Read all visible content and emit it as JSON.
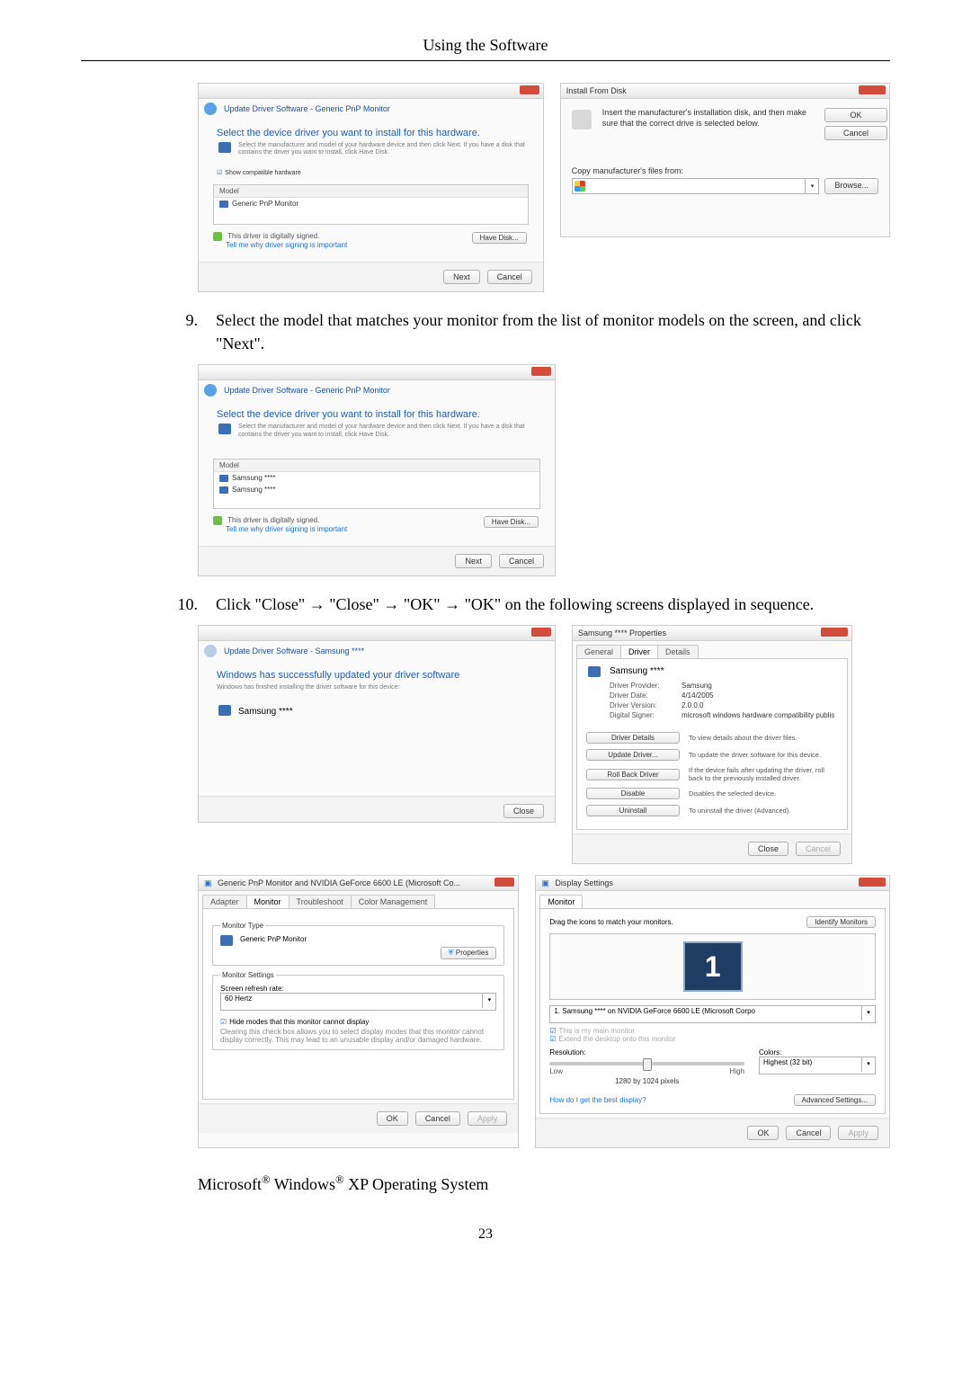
{
  "header_title": "Using the Software",
  "step9": {
    "num": "9.",
    "text": "Select the model that matches your monitor from the list of monitor models on the screen, and click \"Next\"."
  },
  "step10": {
    "num": "10.",
    "text": "Click \"Close\" → \"Close\" → \"OK\" → \"OK\" on the following screens displayed in sequence."
  },
  "dlg_driver": {
    "breadcrumb": "Update Driver Software - Generic PnP Monitor",
    "heading": "Select the device driver you want to install for this hardware.",
    "desc": "Select the manufacturer and model of your hardware device and then click Next. If you have a disk that contains the driver you want to install, click Have Disk.",
    "chk": "Show compatible hardware",
    "col": "Model",
    "item": "Generic PnP Monitor",
    "signed": "This driver is digitally signed.",
    "tell": "Tell me why driver signing is important",
    "have_disk": "Have Disk...",
    "next": "Next",
    "cancel": "Cancel"
  },
  "dlg_ifd": {
    "title": "Install From Disk",
    "msg": "Insert the manufacturer's installation disk, and then make sure that the correct drive is selected below.",
    "ok": "OK",
    "cancel": "Cancel",
    "copy": "Copy manufacturer's files from:",
    "browse": "Browse..."
  },
  "dlg_model": {
    "breadcrumb": "Update Driver Software - Generic PnP Monitor",
    "heading": "Select the device driver you want to install for this hardware.",
    "desc": "Select the manufacturer and model of your hardware device and then click Next. If you have a disk that contains the driver you want to install, click Have Disk.",
    "col": "Model",
    "item1": "Samsung ****",
    "item2": "Samsung ****",
    "signed": "This driver is digitally signed.",
    "tell": "Tell me why driver signing is important",
    "have_disk": "Have Disk...",
    "next": "Next",
    "cancel": "Cancel"
  },
  "dlg_success": {
    "breadcrumb": "Update Driver Software - Samsung ****",
    "heading": "Windows has successfully updated your driver software",
    "desc": "Windows has finished installing the driver software for this device:",
    "item": "Samsung ****",
    "close": "Close"
  },
  "dlg_props": {
    "title": "Samsung **** Properties",
    "tabs": {
      "general": "General",
      "driver": "Driver",
      "details": "Details"
    },
    "name": "Samsung ****",
    "rows": {
      "provider_k": "Driver Provider:",
      "provider_v": "Samsung",
      "date_k": "Driver Date:",
      "date_v": "4/14/2005",
      "version_k": "Driver Version:",
      "version_v": "2.0.0.0",
      "signer_k": "Digital Signer:",
      "signer_v": "microsoft windows hardware compatibility publis"
    },
    "btns": {
      "details": "Driver Details",
      "details_d": "To view details about the driver files.",
      "update": "Update Driver...",
      "update_d": "To update the driver software for this device.",
      "rollback": "Roll Back Driver",
      "rollback_d": "If the device fails after updating the driver, roll back to the previously installed driver.",
      "disable": "Disable",
      "disable_d": "Disables the selected device.",
      "uninstall": "Uninstall",
      "uninstall_d": "To uninstall the driver (Advanced)."
    },
    "close": "Close",
    "cancel": "Cancel"
  },
  "dlg_monprops": {
    "title": "Generic PnP Monitor and NVIDIA GeForce 6600 LE (Microsoft Co...",
    "tabs": {
      "adapter": "Adapter",
      "monitor": "Monitor",
      "troubleshoot": "Troubleshoot",
      "color": "Color Management"
    },
    "type_lbl": "Monitor Type",
    "type_val": "Generic PnP Monitor",
    "properties": "Properties",
    "settings_lbl": "Monitor Settings",
    "refresh_lbl": "Screen refresh rate:",
    "refresh_val": "60 Hertz",
    "hide": "Hide modes that this monitor cannot display",
    "hide_desc": "Clearing this check box allows you to select display modes that this monitor cannot display correctly. This may lead to an unusable display and/or damaged hardware.",
    "ok": "OK",
    "cancel": "Cancel",
    "apply": "Apply"
  },
  "dlg_disp": {
    "title": "Display Settings",
    "tab": "Monitor",
    "drag": "Drag the icons to match your monitors.",
    "identify": "Identify Monitors",
    "mon_num": "1",
    "combo": "1. Samsung **** on NVIDIA GeForce 6600 LE (Microsoft Corpo",
    "main": "This is my main monitor",
    "extend": "Extend the desktop onto this monitor",
    "res_lbl": "Resolution:",
    "low": "Low",
    "high": "High",
    "res_val": "1280 by 1024 pixels",
    "colors_lbl": "Colors:",
    "colors_val": "Highest (32 bit)",
    "best": "How do I get the best display?",
    "adv": "Advanced Settings...",
    "ok": "OK",
    "cancel": "Cancel",
    "apply": "Apply"
  },
  "footer": {
    "pre": "Microsoft",
    "mid": " Windows",
    "post": " XP Operating System",
    "reg": "®"
  },
  "pagenum": "23"
}
